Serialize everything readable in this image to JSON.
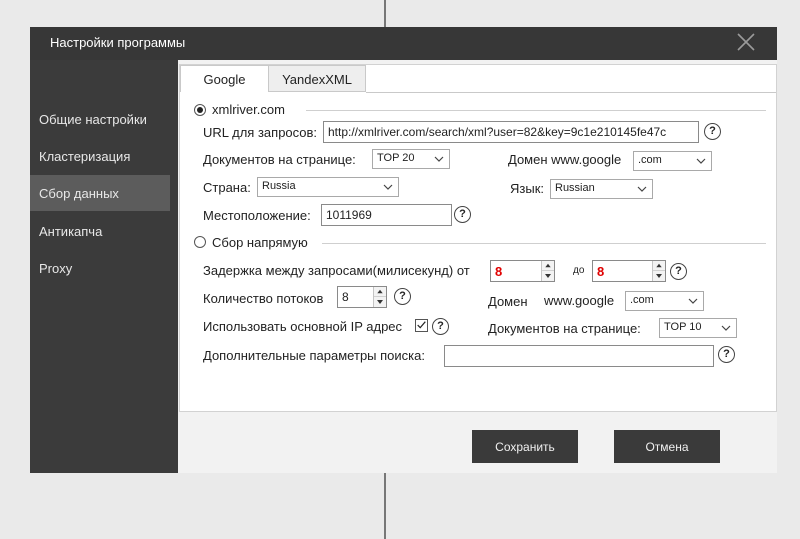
{
  "window": {
    "title": "Настройки программы"
  },
  "sidebar": {
    "items": [
      {
        "label": "Общие настройки"
      },
      {
        "label": "Кластеризация"
      },
      {
        "label": "Сбор данных"
      },
      {
        "label": "Антикапча"
      },
      {
        "label": "Proxy"
      }
    ],
    "active_index": 2
  },
  "tabs": [
    {
      "label": "Google"
    },
    {
      "label": "YandexXML"
    }
  ],
  "xmlriver": {
    "radio_label": "xmlriver.com",
    "selected": true,
    "url_label": "URL для запросов:",
    "url_value": "http://xmlriver.com/search/xml?user=82&key=9c1e210145fe47c",
    "docs_label": "Документов на странице:",
    "docs_value": "TOP 20",
    "domain_label": "Домен www.google",
    "domain_value": ".com",
    "country_label": "Страна:",
    "country_value": "Russia",
    "lang_label": "Язык:",
    "lang_value": "Russian",
    "location_label": "Местоположение:",
    "location_value": "1011969"
  },
  "direct": {
    "radio_label": "Сбор напрямую",
    "selected": false,
    "delay_label": "Задержка между запросами(милисекунд) от",
    "delay_from": "8",
    "to_label": "до",
    "delay_to": "8",
    "threads_label": "Количество потоков",
    "threads_value": "8",
    "domain_label": "Домен",
    "domain_prefix": "www.google",
    "domain_value": ".com",
    "main_ip_label": "Использовать основной IP адрес",
    "main_ip_checked": true,
    "docs_label": "Документов на странице:",
    "docs_value": "TOP 10",
    "extra_label": "Дополнительные параметры поиска:",
    "extra_value": ""
  },
  "buttons": {
    "save": "Сохранить",
    "cancel": "Отмена"
  },
  "help_glyph": "?",
  "colors": {
    "titlebar": "#373737",
    "sidebar": "#3b3b3b",
    "sidebar_active": "#5c5c5c",
    "button": "#3a3a3a",
    "spin_value": "#e00000"
  }
}
